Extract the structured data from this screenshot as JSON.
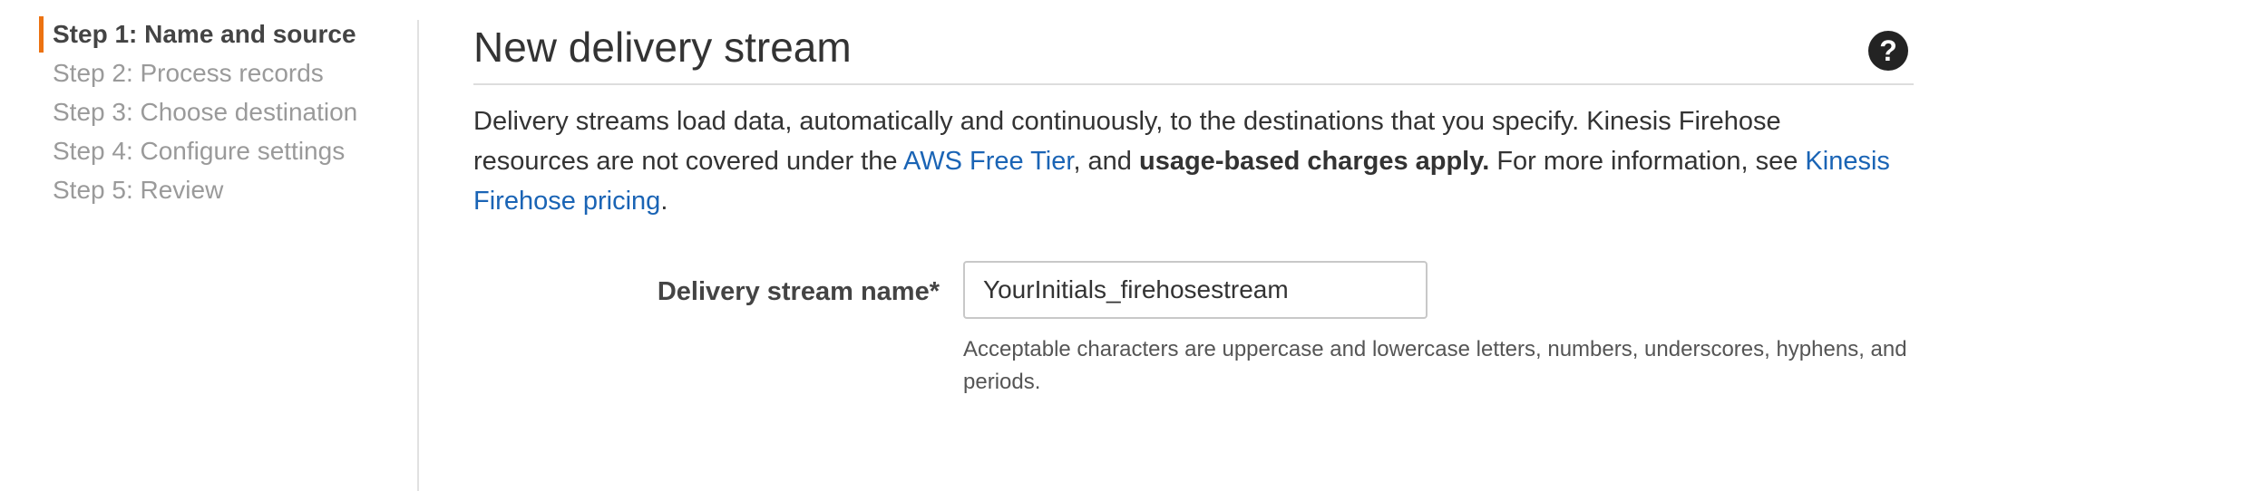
{
  "wizard": {
    "steps": [
      {
        "label": "Step 1: Name and source",
        "active": true
      },
      {
        "label": "Step 2: Process records",
        "active": false
      },
      {
        "label": "Step 3: Choose destination",
        "active": false
      },
      {
        "label": "Step 4: Configure settings",
        "active": false
      },
      {
        "label": "Step 5: Review",
        "active": false
      }
    ]
  },
  "main": {
    "title": "New delivery stream",
    "help_icon": "question-circle-icon",
    "description": {
      "text_1": "Delivery streams load data, automatically and continuously, to the destinations that you specify. Kinesis Firehose resources are not covered under the ",
      "link_free_tier": "AWS Free Tier",
      "text_2": ", and ",
      "bold_charges": "usage-based charges apply.",
      "text_3": " For more information, see ",
      "link_pricing": "Kinesis Firehose pricing",
      "text_4": "."
    },
    "form": {
      "stream_name_label": "Delivery stream name*",
      "stream_name_value": "YourInitials_firehosestream",
      "stream_name_help": "Acceptable characters are uppercase and lowercase letters, numbers, underscores, hyphens, and periods."
    }
  },
  "colors": {
    "accent": "#ec7211",
    "link": "#1a64b5",
    "active_text": "#444444",
    "inactive_text": "#9a9a9a"
  }
}
